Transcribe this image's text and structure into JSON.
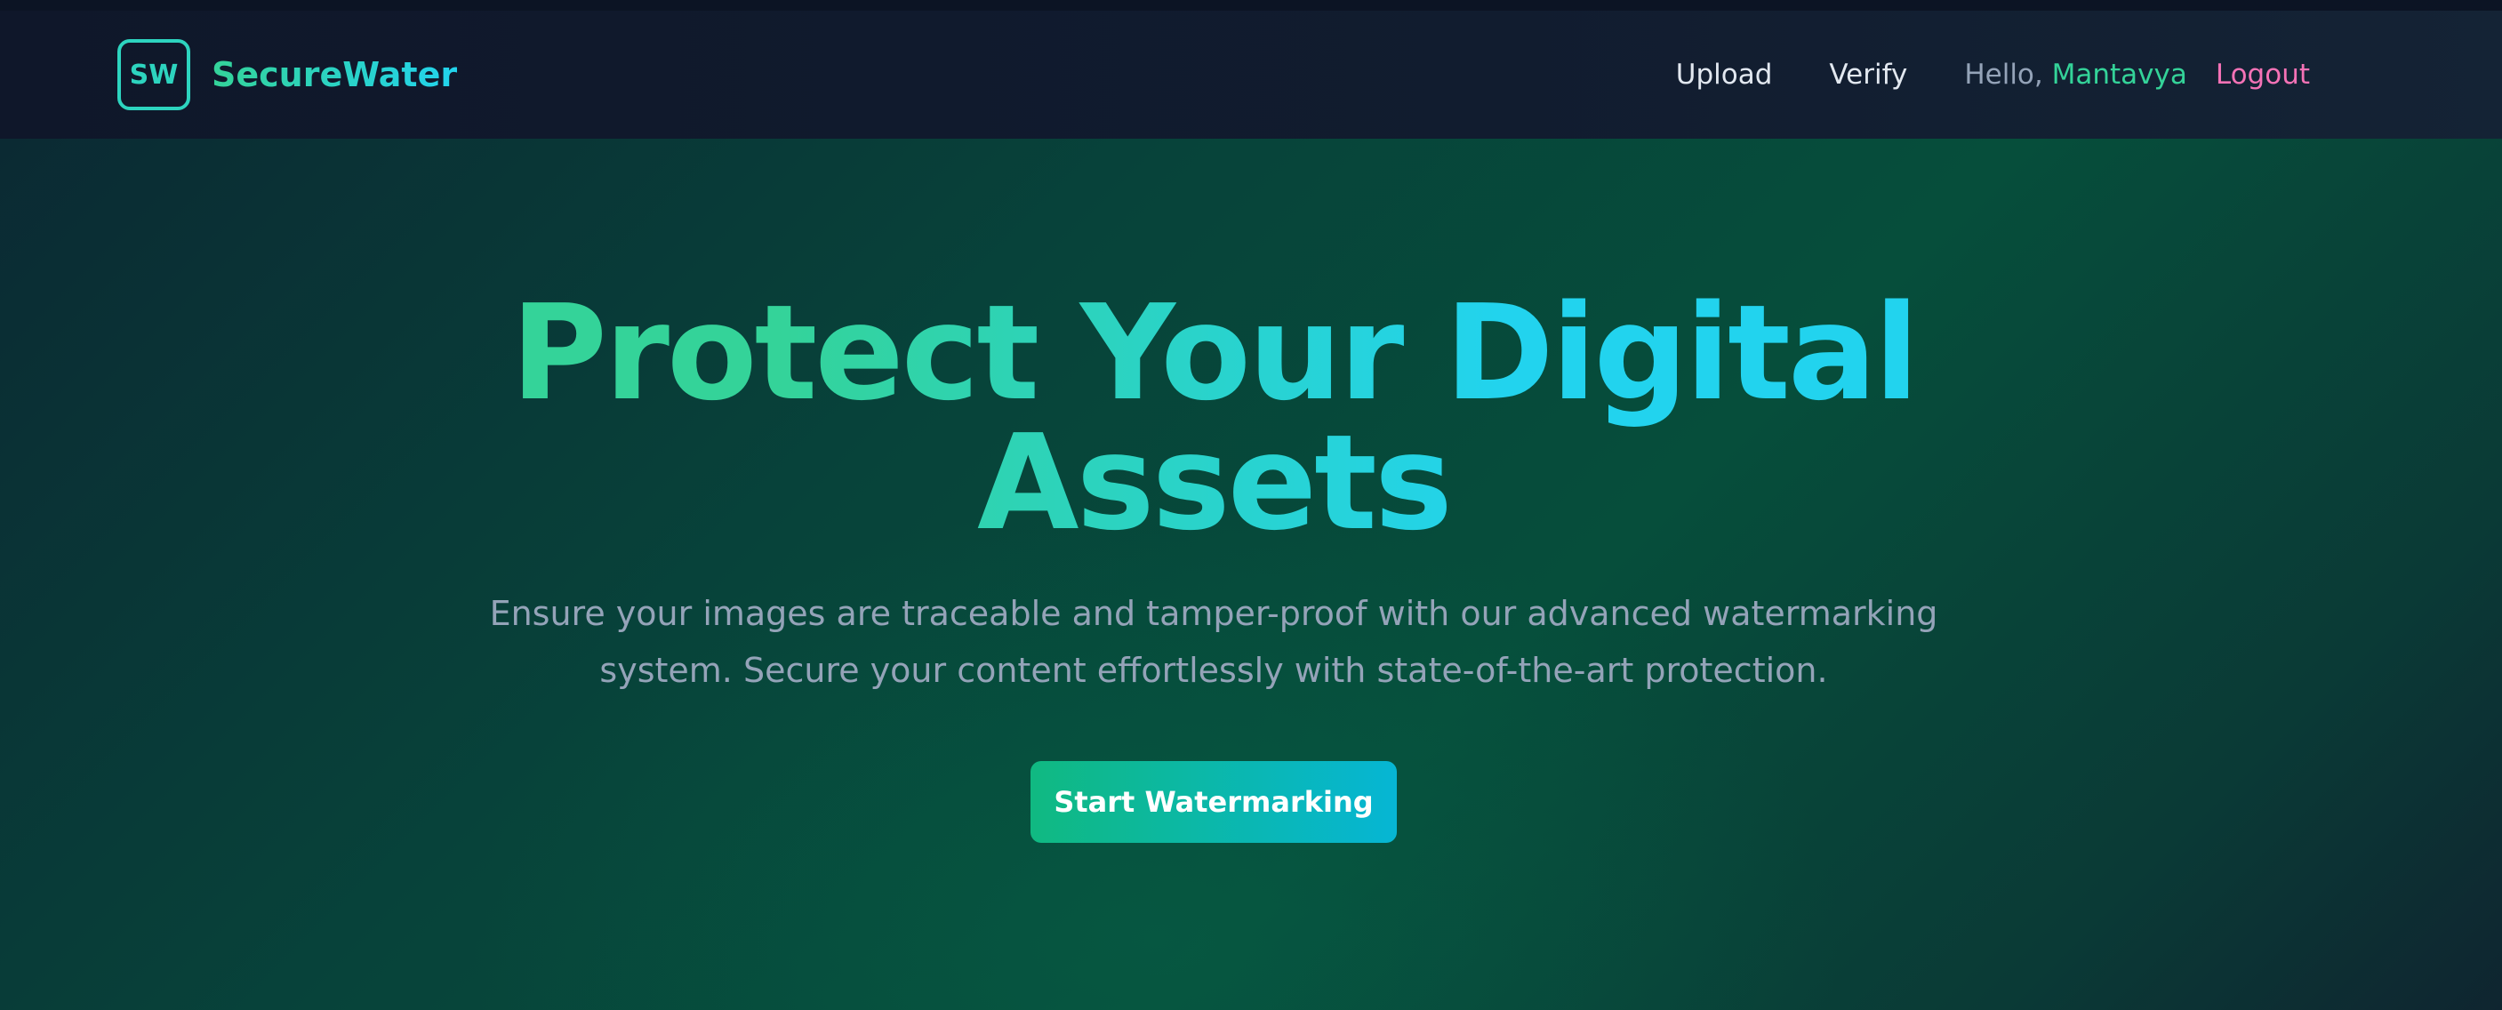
{
  "brand": {
    "badge": "SW",
    "name": "SecureWater"
  },
  "nav": {
    "upload": "Upload",
    "verify": "Verify",
    "greeting_prefix": "Hello,",
    "username": "Mantavya",
    "logout": "Logout"
  },
  "hero": {
    "title_line1": "Protect Your Digital",
    "title_line2": "Assets",
    "subtitle_line1": "Ensure your images are traceable and tamper-proof with our advanced watermarking",
    "subtitle_line2": "system. Secure your content effortlessly with state-of-the-art protection.",
    "cta_label": "Start Watermarking"
  },
  "colors": {
    "accent_green": "#34d399",
    "accent_cyan": "#22d3ee",
    "logout_pink": "#f472b6",
    "nav_background": "#0f172a"
  }
}
